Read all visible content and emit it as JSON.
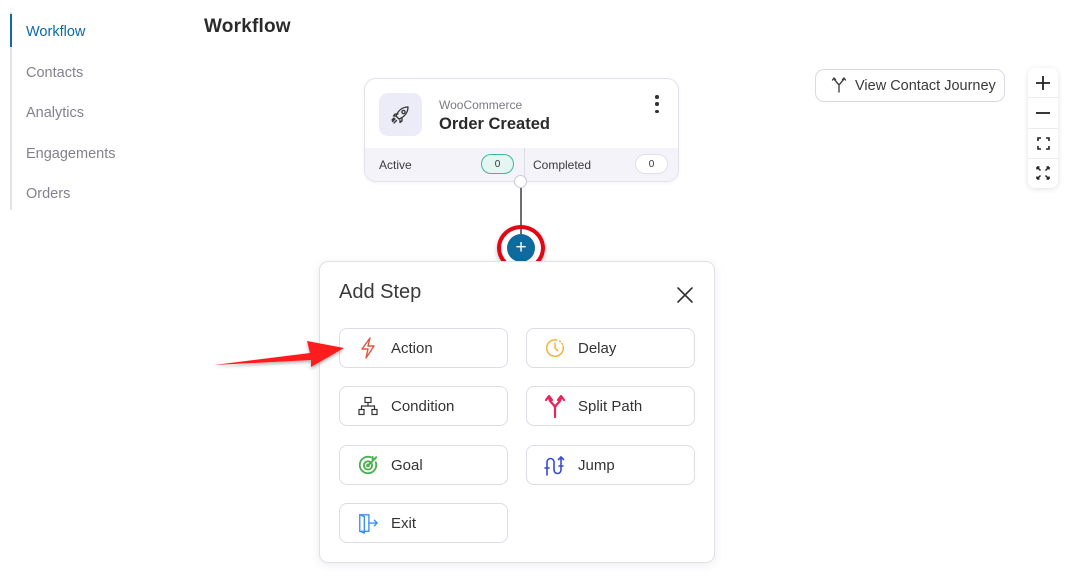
{
  "sidebar": {
    "items": [
      {
        "label": "Workflow",
        "active": true
      },
      {
        "label": "Contacts",
        "active": false
      },
      {
        "label": "Analytics",
        "active": false
      },
      {
        "label": "Engagements",
        "active": false
      },
      {
        "label": "Orders",
        "active": false
      }
    ]
  },
  "header": {
    "title": "Workflow"
  },
  "trigger": {
    "icon": "rocket-icon",
    "source": "WooCommerce",
    "title": "Order Created",
    "stats": {
      "active_label": "Active",
      "active_count": "0",
      "completed_label": "Completed",
      "completed_count": "0"
    }
  },
  "add_button": {
    "icon": "plus-icon",
    "label": "+"
  },
  "toolbar": {
    "journey_label": "View Contact Journey",
    "journey_icon": "split-arrows-icon",
    "zoom_in": "+",
    "zoom_out": "−",
    "fit_icon": "fit-screen-icon",
    "fullscreen_icon": "fullscreen-icon"
  },
  "add_step": {
    "title": "Add Step",
    "close_icon": "close-icon",
    "steps": [
      {
        "label": "Action",
        "icon": "lightning-icon",
        "color": "#e5533d"
      },
      {
        "label": "Delay",
        "icon": "clock-icon",
        "color": "#f2b233"
      },
      {
        "label": "Condition",
        "icon": "hierarchy-icon",
        "color": "#333333"
      },
      {
        "label": "Split Path",
        "icon": "split-path-icon",
        "color": "#e5265a"
      },
      {
        "label": "Goal",
        "icon": "target-icon",
        "color": "#4caf50"
      },
      {
        "label": "Jump",
        "icon": "jump-icon",
        "color": "#3949d6"
      },
      {
        "label": "Exit",
        "icon": "exit-door-icon",
        "color": "#3f8ff0"
      }
    ]
  },
  "annotation": {
    "arrow_color": "#ff1a1a",
    "highlight_color": "#e30613"
  }
}
